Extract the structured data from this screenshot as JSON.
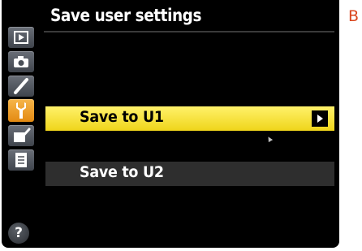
{
  "header": {
    "title": "Save user settings"
  },
  "sidebar": {
    "items": [
      {
        "icon": "playback-icon",
        "active": false
      },
      {
        "icon": "camera-icon",
        "active": false
      },
      {
        "icon": "pencil-icon",
        "active": false
      },
      {
        "icon": "wrench-icon",
        "active": true
      },
      {
        "icon": "retouch-icon",
        "active": false
      },
      {
        "icon": "my-menu-icon",
        "active": false
      }
    ],
    "help_symbol": "?"
  },
  "menu": {
    "items": [
      {
        "label": "Save to U1",
        "selected": true,
        "has_submenu_arrow": true
      },
      {
        "label": "Save to U2",
        "selected": false,
        "has_submenu_arrow": false
      }
    ]
  },
  "corner_label": "B",
  "colors": {
    "screen_background": "#000000",
    "selected_highlight": "#f5e03a",
    "unselected_row": "#2e2e2e",
    "active_tab": "#f0a030",
    "inactive_tab": "#555a62",
    "corner_label": "#d9461e"
  }
}
